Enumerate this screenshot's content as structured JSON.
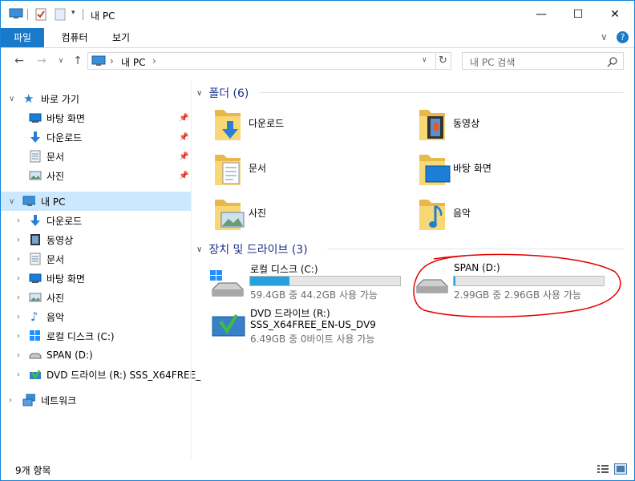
{
  "window": {
    "title": "내 PC"
  },
  "ribbon": {
    "tabs": [
      "파일",
      "컴퓨터",
      "보기"
    ]
  },
  "address": {
    "path_root": "내 PC"
  },
  "search": {
    "placeholder": "내 PC 검색"
  },
  "nav": {
    "quick_access": "바로 가기",
    "quick_items": [
      "바탕 화면",
      "다운로드",
      "문서",
      "사진"
    ],
    "this_pc": "내 PC",
    "pc_items": [
      "다운로드",
      "동영상",
      "문서",
      "바탕 화면",
      "사진",
      "음악",
      "로컬 디스크 (C:)",
      "SPAN (D:)",
      "DVD 드라이브 (R:) SSS_X64FREE_"
    ],
    "network": "네트워크"
  },
  "folders": {
    "header": "폴더 (6)",
    "items": [
      "다운로드",
      "동영상",
      "문서",
      "바탕 화면",
      "사진",
      "음악"
    ]
  },
  "devices": {
    "header": "장치 및 드라이브 (3)",
    "c": {
      "name": "로컬 디스크 (C:)",
      "free": "59.4GB 중 44.2GB 사용 가능",
      "used_fraction": 0.26
    },
    "d": {
      "name": "SPAN (D:)",
      "free": "2.99GB 중 2.96GB 사용 가능",
      "used_fraction": 0.01
    },
    "r": {
      "name": "DVD 드라이브 (R:)",
      "label": "SSS_X64FREE_EN-US_DV9",
      "free": "6.49GB 중 0바이트 사용 가능"
    }
  },
  "status": {
    "count": "9개 항목"
  },
  "colors": {
    "accent": "#1979ca",
    "annotation": "#e00000",
    "bar_fill": "#26a0da"
  }
}
